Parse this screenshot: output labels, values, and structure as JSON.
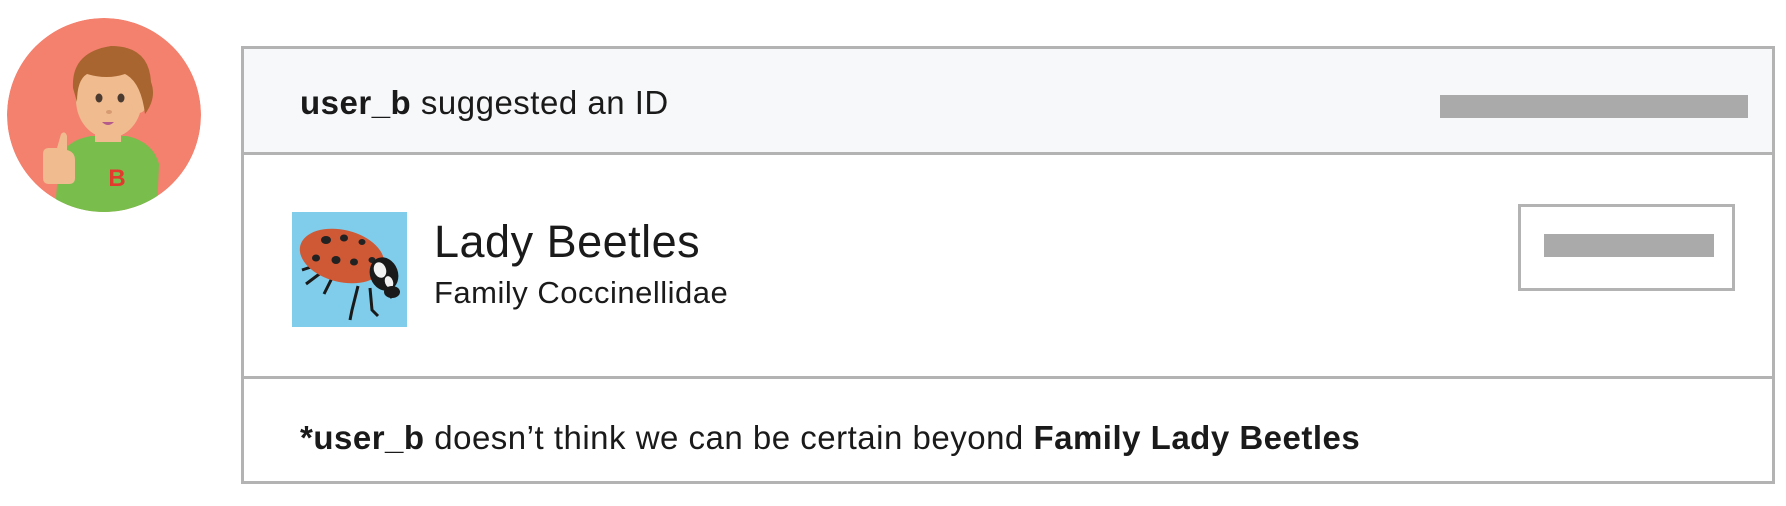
{
  "avatar": {
    "icon": "user-avatar-icon",
    "initial": "B",
    "colors": {
      "background": "#f4806e",
      "shirt": "#79bd4d",
      "skin": "#efbb8f",
      "hair": "#a8652f",
      "initial": "#e23b2e"
    }
  },
  "header": {
    "username": "user_b",
    "action": "suggested an ID"
  },
  "taxon": {
    "common_name": "Lady Beetles",
    "scientific_name": "Family Coccinellidae",
    "photo_icon": "ladybug-icon",
    "photo_background": "#7fcdea"
  },
  "note": {
    "prefix": "*",
    "username": "user_b",
    "text": "doesn’t think we can be certain beyond",
    "taxon": "Family Lady Beetles"
  },
  "colors": {
    "border": "#b3b3b3",
    "header_bg": "#f7f8fa",
    "placeholder_bar": "#aaaaaa"
  }
}
